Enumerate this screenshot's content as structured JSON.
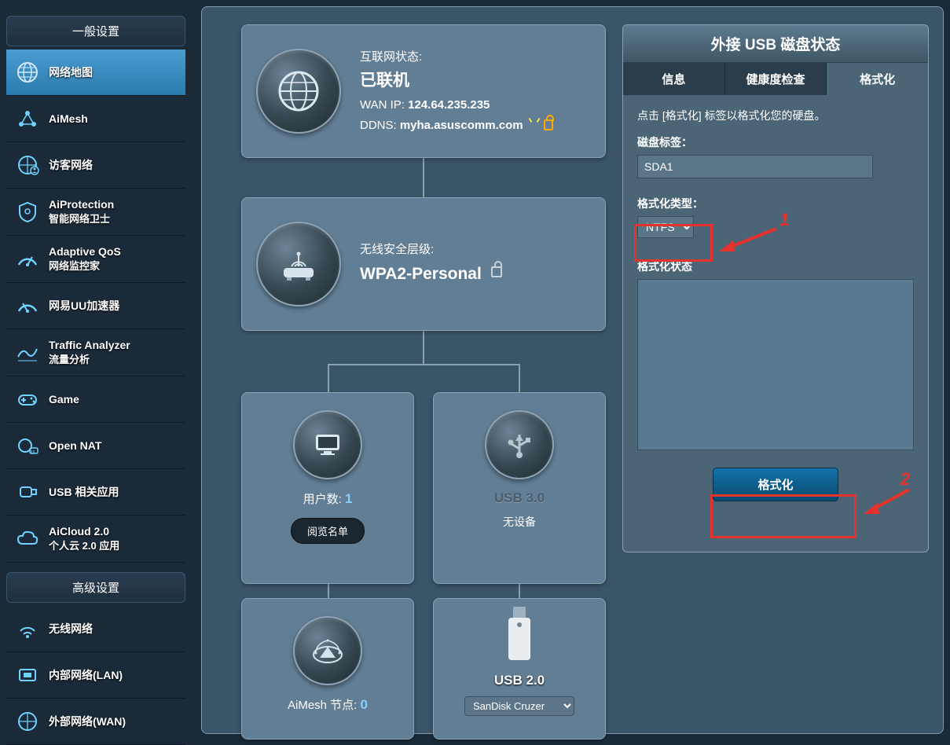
{
  "sidebar": {
    "general_header": "一般设置",
    "advanced_header": "高级设置",
    "items": [
      {
        "label": "网络地图"
      },
      {
        "label": "AiMesh"
      },
      {
        "label": "访客网络"
      },
      {
        "label": "AiProtection",
        "sub": "智能网络卫士"
      },
      {
        "label": "Adaptive QoS",
        "sub": "网络监控家"
      },
      {
        "label": "网易UU加速器"
      },
      {
        "label": "Traffic Analyzer",
        "sub": "流量分析"
      },
      {
        "label": "Game"
      },
      {
        "label": "Open NAT"
      },
      {
        "label": "USB 相关应用"
      },
      {
        "label": "AiCloud 2.0",
        "sub": "个人云 2.0 应用"
      }
    ],
    "adv_items": [
      {
        "label": "无线网络"
      },
      {
        "label": "内部网络(LAN)"
      },
      {
        "label": "外部网络(WAN)"
      }
    ]
  },
  "internet": {
    "status_label": "互联网状态:",
    "status_value": "已联机",
    "wan_label": "WAN IP:",
    "wan_value": "124.64.235.235",
    "ddns_label": "DDNS:",
    "ddns_value": "myha.asuscomm.com"
  },
  "wifi": {
    "label": "无线安全层级:",
    "value": "WPA2-Personal"
  },
  "clients": {
    "label": "用户数:",
    "value": "1",
    "button": "阅览名单"
  },
  "usb3": {
    "title": "USB 3.0",
    "sub": "无设备"
  },
  "aimesh": {
    "label": "AiMesh 节点:",
    "value": "0"
  },
  "usb2": {
    "title": "USB 2.0",
    "selected": "SanDisk Cruzer"
  },
  "right": {
    "title": "外接 USB 磁盘状态",
    "tabs": {
      "info": "信息",
      "health": "健康度检查",
      "format": "格式化"
    },
    "hint": "点击 [格式化] 标签以格式化您的硬盘。",
    "disk_label_label": "磁盘标签：",
    "disk_label_value": "SDA1",
    "format_type_label": "格式化类型：",
    "format_type_value": "NTFS",
    "status_label": "格式化状态",
    "button": "格式化"
  },
  "annotations": {
    "n1": "1",
    "n2": "2"
  }
}
